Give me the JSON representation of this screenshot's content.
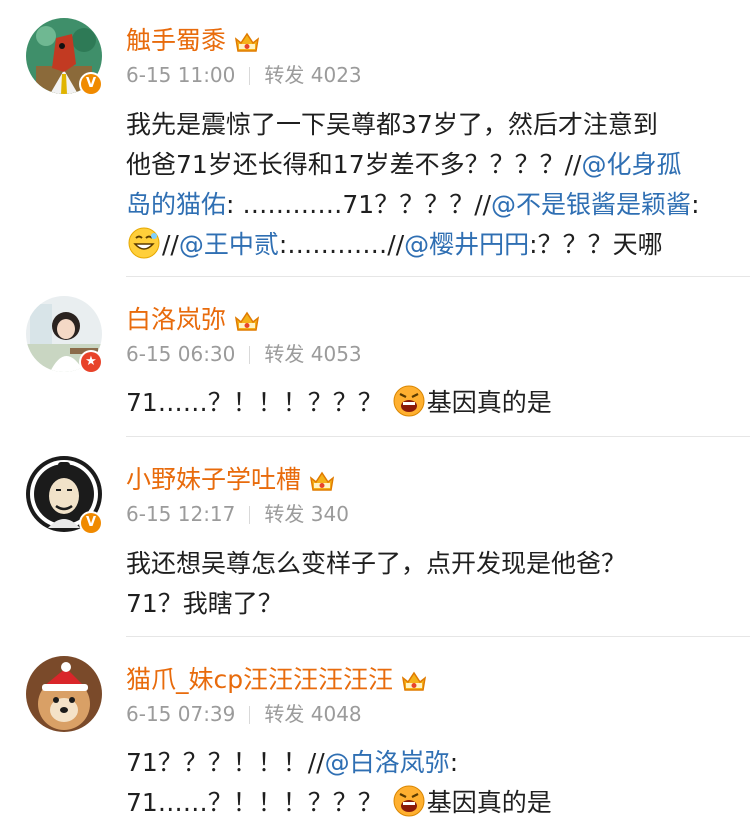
{
  "comments": [
    {
      "username": "触手蜀黍",
      "date": "6-15 11:00",
      "repost_label": "转发",
      "repost_count": "4023",
      "lines": [
        [
          "我先是震惊了一下吴尊都37岁了，然后才注意到"
        ],
        [
          "他爸71岁还长得和17岁差不多？？？？//",
          "@化身孤"
        ],
        [
          "岛的猫佑",
          ": …………71？？？？//",
          "@不是银酱是颖酱",
          ":"
        ],
        [
          "//",
          "@王中贰",
          ":…………//",
          "@樱井円円",
          ":？？？天哪"
        ]
      ]
    },
    {
      "username": "白洛岚弥",
      "date": "6-15 06:30",
      "repost_label": "转发",
      "repost_count": "4053",
      "text_before": "71……？！！！？？？",
      "text_after": "基因真的是"
    },
    {
      "username": "小野妹子学吐槽",
      "date": "6-15 12:17",
      "repost_label": "转发",
      "repost_count": "340",
      "line1": "我还想吴尊怎么变样子了，点开发现是他爸？",
      "line2": "71？我瞎了？"
    },
    {
      "username": "猫爪_妹cp汪汪汪汪汪汪",
      "date": "6-15 07:39",
      "repost_label": "转发",
      "repost_count": "4048",
      "line1_text": "71？？？！！！//",
      "line1_link": "@白洛岚弥",
      "line1_tail": ":",
      "line2_before": "71……？！！！？？？",
      "line2_after": "基因真的是"
    }
  ],
  "colors": {
    "username": "#e86b0c",
    "link": "#2f6fb3",
    "meta": "#9b9b9b",
    "verified_orange": "#f08a00",
    "verified_red": "#e8432a"
  },
  "icons": {
    "crown": "vip-crown-icon",
    "grin_emoji": "grin-emoji-icon",
    "angry_emoji": "angry-emoji-icon",
    "verified": "verified-badge-icon"
  }
}
